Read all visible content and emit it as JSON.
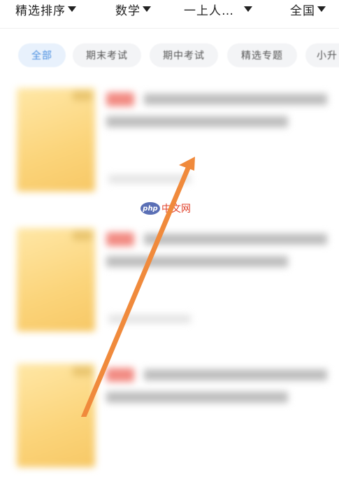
{
  "filters": {
    "sort": "精选排序",
    "subject": "数学",
    "grade": "一上人…",
    "region": "全国"
  },
  "tabs": [
    {
      "label": "全部",
      "active": true
    },
    {
      "label": "期末考试"
    },
    {
      "label": "期中考试"
    },
    {
      "label": "精选专题"
    },
    {
      "label": "小升"
    }
  ],
  "watermark": {
    "logo": "php",
    "text": "中文网"
  },
  "colors": {
    "accent": "#4a8fe0",
    "arrow": "#f08a3c",
    "cover": "#fbd47a"
  }
}
